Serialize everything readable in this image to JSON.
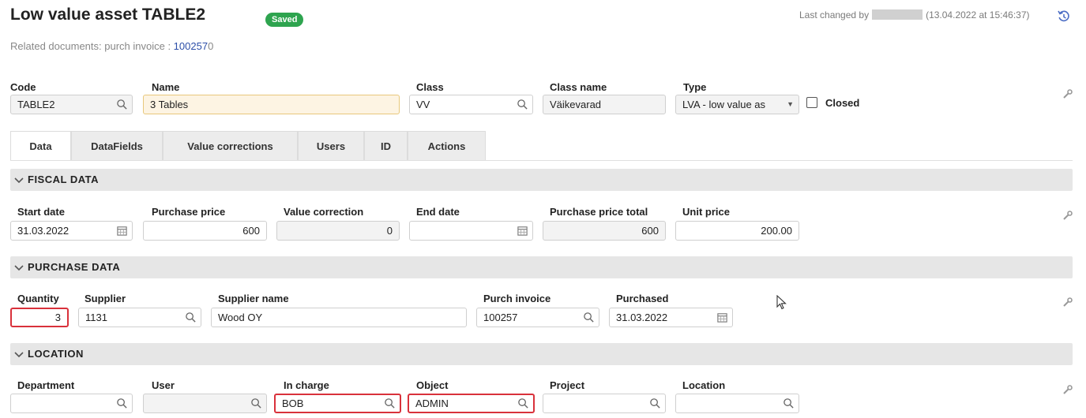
{
  "header": {
    "title": "Low value asset TABLE2",
    "status_badge": "Saved",
    "last_changed_prefix": "Last changed by",
    "last_changed_time": "(13.04.2022 at 15:46:37)",
    "related_label": "Related documents:  purch invoice : ",
    "related_link": "100257",
    "related_suffix": "0"
  },
  "main_fields": {
    "code_label": "Code",
    "code_value": "TABLE2",
    "name_label": "Name",
    "name_value": "3 Tables",
    "class_label": "Class",
    "class_value": "VV",
    "class_name_label": "Class name",
    "class_name_value": "Väikevarad",
    "type_label": "Type",
    "type_value": "LVA - low value as",
    "closed_label": "Closed",
    "closed_checked": false
  },
  "tabs": [
    {
      "label": "Data",
      "active": true
    },
    {
      "label": "DataFields"
    },
    {
      "label": "Value corrections"
    },
    {
      "label": "Users"
    },
    {
      "label": "ID"
    },
    {
      "label": "Actions"
    }
  ],
  "fiscal": {
    "section_title": "FISCAL DATA",
    "start_date_label": "Start date",
    "start_date_value": "31.03.2022",
    "purchase_price_label": "Purchase price",
    "purchase_price_value": "600",
    "value_correction_label": "Value correction",
    "value_correction_value": "0",
    "end_date_label": "End date",
    "end_date_value": "",
    "purchase_price_total_label": "Purchase price total",
    "purchase_price_total_value": "600",
    "unit_price_label": "Unit price",
    "unit_price_value": "200.00"
  },
  "purchase": {
    "section_title": "PURCHASE DATA",
    "quantity_label": "Quantity",
    "quantity_value": "3",
    "supplier_label": "Supplier",
    "supplier_value": "1131",
    "supplier_name_label": "Supplier name",
    "supplier_name_value": "Wood OY",
    "purch_invoice_label": "Purch invoice",
    "purch_invoice_value": "100257",
    "purchased_label": "Purchased",
    "purchased_value": "31.03.2022"
  },
  "location": {
    "section_title": "LOCATION",
    "department_label": "Department",
    "department_value": "",
    "user_label": "User",
    "user_value": "",
    "in_charge_label": "In charge",
    "in_charge_value": "BOB",
    "object_label": "Object",
    "object_value": "ADMIN",
    "project_label": "Project",
    "project_value": "",
    "location_label": "Location",
    "location_value": ""
  },
  "colors": {
    "badge": "#2ea44f",
    "highlight_border": "#d9313b",
    "link": "#2d4fa8",
    "name_field_bg": "#fdf4e3"
  },
  "icons": [
    "history-icon",
    "search-icon",
    "calendar-icon",
    "chevron-down-icon",
    "wrench-icon",
    "cursor-icon"
  ]
}
